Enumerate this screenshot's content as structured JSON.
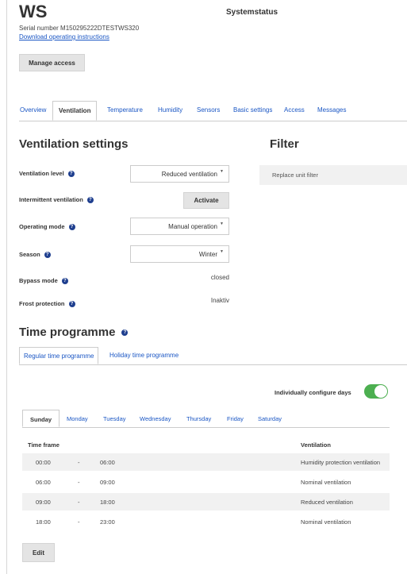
{
  "header": {
    "device_name": "WS",
    "serial": "Serial number M150295222DTESTWS320",
    "manual_link": "Download operating instructions",
    "system_status": "Systemstatus",
    "manage_access": "Manage access"
  },
  "tabs": [
    "Overview",
    "Ventilation",
    "Temperature",
    "Humidity",
    "Sensors",
    "Basic settings",
    "Access",
    "Messages"
  ],
  "active_tab": "Ventilation",
  "ventilation": {
    "heading": "Ventilation settings",
    "help_glyph": "?",
    "level_label": "Ventilation level",
    "level_value": "Reduced ventilation",
    "intermittent_label": "Intermittent ventilation",
    "activate_button": "Activate",
    "mode_label": "Operating mode",
    "mode_value": "Manual operation",
    "season_label": "Season",
    "season_value": "Winter",
    "bypass_label": "Bypass mode",
    "bypass_value": "closed",
    "frost_label": "Frost protection",
    "frost_value": "Inaktiv"
  },
  "filter": {
    "heading": "Filter",
    "replace": "Replace unit filter"
  },
  "time_programme": {
    "heading": "Time programme",
    "tabs": [
      "Regular time programme",
      "Holiday time programme"
    ],
    "configure_days_label": "Individually configure days",
    "configure_days_on": true,
    "days": [
      "Sunday",
      "Monday",
      "Tuesday",
      "Wednesday",
      "Thursday",
      "Friday",
      "Saturday"
    ],
    "active_day": "Sunday",
    "col_time_frame": "Time frame",
    "col_ventilation": "Ventilation",
    "separator": "-",
    "rows": [
      {
        "from": "00:00",
        "to": "06:00",
        "ventilation": "Humidity protection ventilation"
      },
      {
        "from": "06:00",
        "to": "09:00",
        "ventilation": "Nominal ventilation"
      },
      {
        "from": "09:00",
        "to": "18:00",
        "ventilation": "Reduced ventilation"
      },
      {
        "from": "18:00",
        "to": "23:00",
        "ventilation": "Nominal ventilation"
      }
    ],
    "edit_button": "Edit"
  },
  "colors": {
    "link": "#1a56c4",
    "help": "#1f3f8f",
    "toggle_on": "#4caf50",
    "row_shade": "#f1f1f1"
  }
}
